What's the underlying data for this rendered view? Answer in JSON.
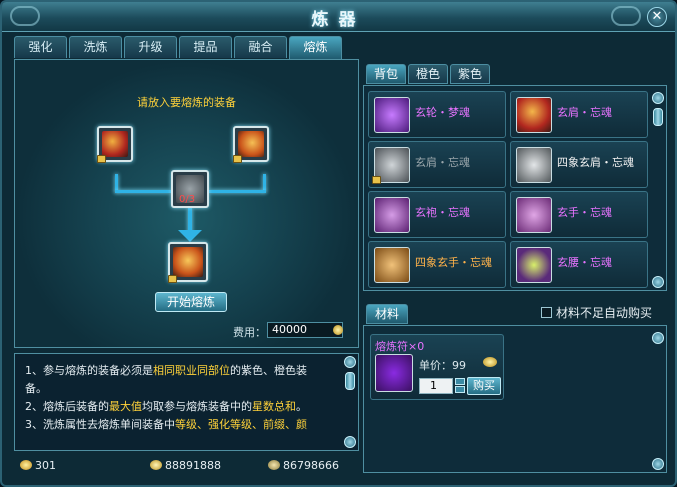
{
  "window": {
    "title": "炼器"
  },
  "tabs": [
    "强化",
    "洗炼",
    "升级",
    "提品",
    "融合",
    "熔炼"
  ],
  "active_tab": "熔炼",
  "smelt": {
    "instruction": "请放入要熔炼的装备",
    "material_count": "0/3",
    "start_label": "开始熔炼",
    "fee_label": "费用：",
    "fee_value": "40000"
  },
  "description": {
    "line1_a": "1、参与熔炼的装备必须是",
    "line1_hl": "相同职业同部位",
    "line1_b": "的紫色、橙色装",
    "line1_c": "备。",
    "line2_a": "2、熔炼后装备的",
    "line2_hl1": "最大值",
    "line2_b": "均取参与熔炼装备中的",
    "line2_hl2": "星数总和",
    "line2_c": "。",
    "line3_a": "3、洗炼属性去熔炼单间装备中",
    "line3_hl": "等级、强化等级、前缀、颜"
  },
  "currency": {
    "gold": "301",
    "coins": "88891888",
    "bound": "86798666"
  },
  "bag": {
    "tabs": [
      "背包",
      "橙色",
      "紫色"
    ],
    "active": "背包",
    "items": [
      {
        "name": "玄轮・梦魂",
        "quality": "purple",
        "color": "#7a2fc4"
      },
      {
        "name": "玄肩・忘魂",
        "quality": "purple",
        "color": "#c0392b"
      },
      {
        "name": "玄肩・忘魂",
        "quality": "gray",
        "color": "#6f7579"
      },
      {
        "name": "四象玄肩・忘魂",
        "quality": "white",
        "color": "#8a9196"
      },
      {
        "name": "玄袍・忘魂",
        "quality": "purple",
        "color": "#9b3ab8"
      },
      {
        "name": "玄手・忘魂",
        "quality": "purple",
        "color": "#a04fb0"
      },
      {
        "name": "四象玄手・忘魂",
        "quality": "orange",
        "color": "#b8812b"
      },
      {
        "name": "玄腰・忘魂",
        "quality": "purple",
        "color": "#7fa832"
      }
    ]
  },
  "material": {
    "tab_label": "材料",
    "autobuy_label": "材料不足自动购买",
    "item_name": "熔炼符×0",
    "price_label": "单价：99",
    "quantity": "1",
    "buy_label": "购买"
  },
  "colors": {
    "accent_yellow": "#ffd23a",
    "purple_quality": "#e873ff",
    "orange_quality": "#ffb24a",
    "connector_blue": "#2fb3e6"
  }
}
